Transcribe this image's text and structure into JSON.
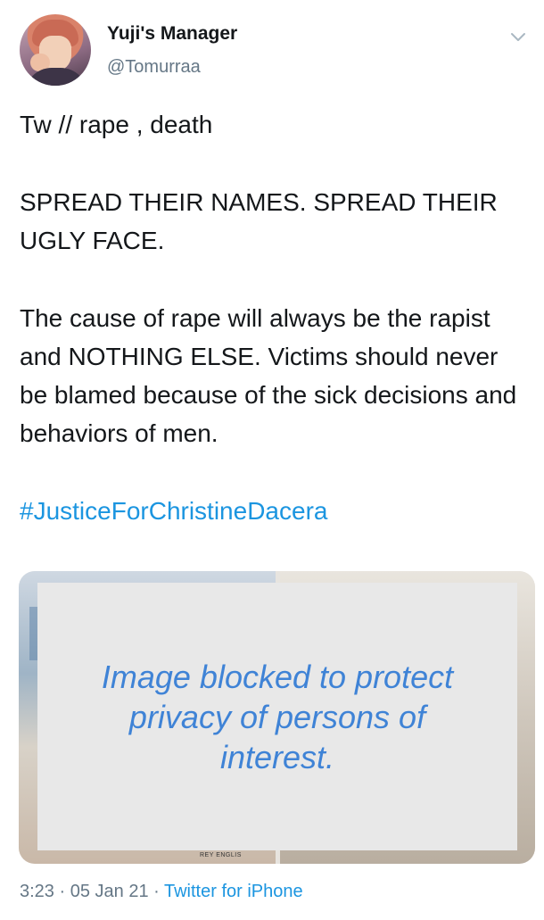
{
  "author": {
    "name": "Yuji's Manager",
    "handle": "@Tomurraa"
  },
  "tweet": {
    "paragraphs": [
      "Tw // rape , death",
      "SPREAD THEIR NAMES. SPREAD THEIR UGLY FACE.",
      "The cause of rape will always be the rapist and NOTHING ELSE. Victims should never be blamed because of the sick decisions and behaviors of men."
    ],
    "hashtag": "#JusticeForChristineDacera"
  },
  "media": {
    "blocked_message": "Image blocked to protect privacy of persons of interest.",
    "caption": "REY ENGLIS"
  },
  "meta": {
    "time": "3:23",
    "separator1": " · ",
    "date": "05 Jan 21",
    "separator2": " · ",
    "source": "Twitter for iPhone"
  },
  "colors": {
    "link": "#1b95e0",
    "secondary_text": "#657786",
    "blocked_text": "#3f83d6"
  },
  "icons": {
    "menu": "chevron-down-icon"
  }
}
